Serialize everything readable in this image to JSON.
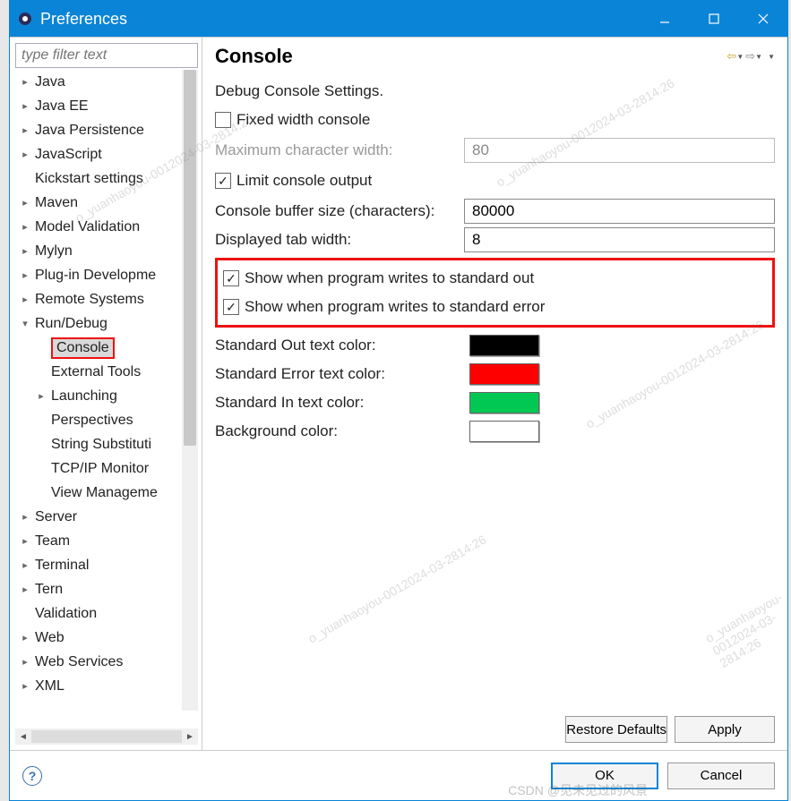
{
  "window": {
    "title": "Preferences"
  },
  "sidebar": {
    "filter_placeholder": "type filter text",
    "items": [
      {
        "label": "Java",
        "exp": ">",
        "lvl": 1
      },
      {
        "label": "Java EE",
        "exp": ">",
        "lvl": 1
      },
      {
        "label": "Java Persistence",
        "exp": ">",
        "lvl": 1
      },
      {
        "label": "JavaScript",
        "exp": ">",
        "lvl": 1
      },
      {
        "label": "Kickstart settings",
        "exp": "",
        "lvl": 1
      },
      {
        "label": "Maven",
        "exp": ">",
        "lvl": 1
      },
      {
        "label": "Model Validation",
        "exp": ">",
        "lvl": 1
      },
      {
        "label": "Mylyn",
        "exp": ">",
        "lvl": 1
      },
      {
        "label": "Plug-in Developme",
        "exp": ">",
        "lvl": 1
      },
      {
        "label": "Remote Systems",
        "exp": ">",
        "lvl": 1
      },
      {
        "label": "Run/Debug",
        "exp": "v",
        "lvl": 1
      },
      {
        "label": "Console",
        "exp": "",
        "lvl": 2,
        "boxed": true
      },
      {
        "label": "External Tools",
        "exp": "",
        "lvl": 2
      },
      {
        "label": "Launching",
        "exp": ">",
        "lvl": 2
      },
      {
        "label": "Perspectives",
        "exp": "",
        "lvl": 2
      },
      {
        "label": "String Substituti",
        "exp": "",
        "lvl": 2
      },
      {
        "label": "TCP/IP Monitor",
        "exp": "",
        "lvl": 2
      },
      {
        "label": "View Manageme",
        "exp": "",
        "lvl": 2
      },
      {
        "label": "Server",
        "exp": ">",
        "lvl": 1
      },
      {
        "label": "Team",
        "exp": ">",
        "lvl": 1
      },
      {
        "label": "Terminal",
        "exp": ">",
        "lvl": 1
      },
      {
        "label": "Tern",
        "exp": ">",
        "lvl": 1
      },
      {
        "label": "Validation",
        "exp": "",
        "lvl": 1
      },
      {
        "label": "Web",
        "exp": ">",
        "lvl": 1
      },
      {
        "label": "Web Services",
        "exp": ">",
        "lvl": 1
      },
      {
        "label": "XML",
        "exp": ">",
        "lvl": 1
      }
    ]
  },
  "main": {
    "title": "Console",
    "settings_heading": "Debug Console Settings.",
    "fixed_width_label": "Fixed width console",
    "max_char_label": "Maximum character width:",
    "max_char_value": "80",
    "limit_output_label": "Limit console output",
    "buffer_label": "Console buffer size (characters):",
    "buffer_value": "80000",
    "tab_width_label": "Displayed tab width:",
    "tab_width_value": "8",
    "show_stdout_label": "Show when program writes to standard out",
    "show_stderr_label": "Show when program writes to standard error",
    "stdout_color_label": "Standard Out text color:",
    "stderr_color_label": "Standard Error text color:",
    "stdin_color_label": "Standard In text color:",
    "bg_color_label": "Background color:",
    "colors": {
      "stdout": "#000000",
      "stderr": "#ff0000",
      "stdin": "#00c853",
      "bg": "#ffffff"
    },
    "restore_defaults": "Restore Defaults",
    "apply": "Apply"
  },
  "bottom": {
    "ok": "OK",
    "cancel": "Cancel"
  },
  "watermark": "o_yuanhaoyou-0012024-03-2814:26",
  "footer_wm": "CSDN @见未见过的风景"
}
